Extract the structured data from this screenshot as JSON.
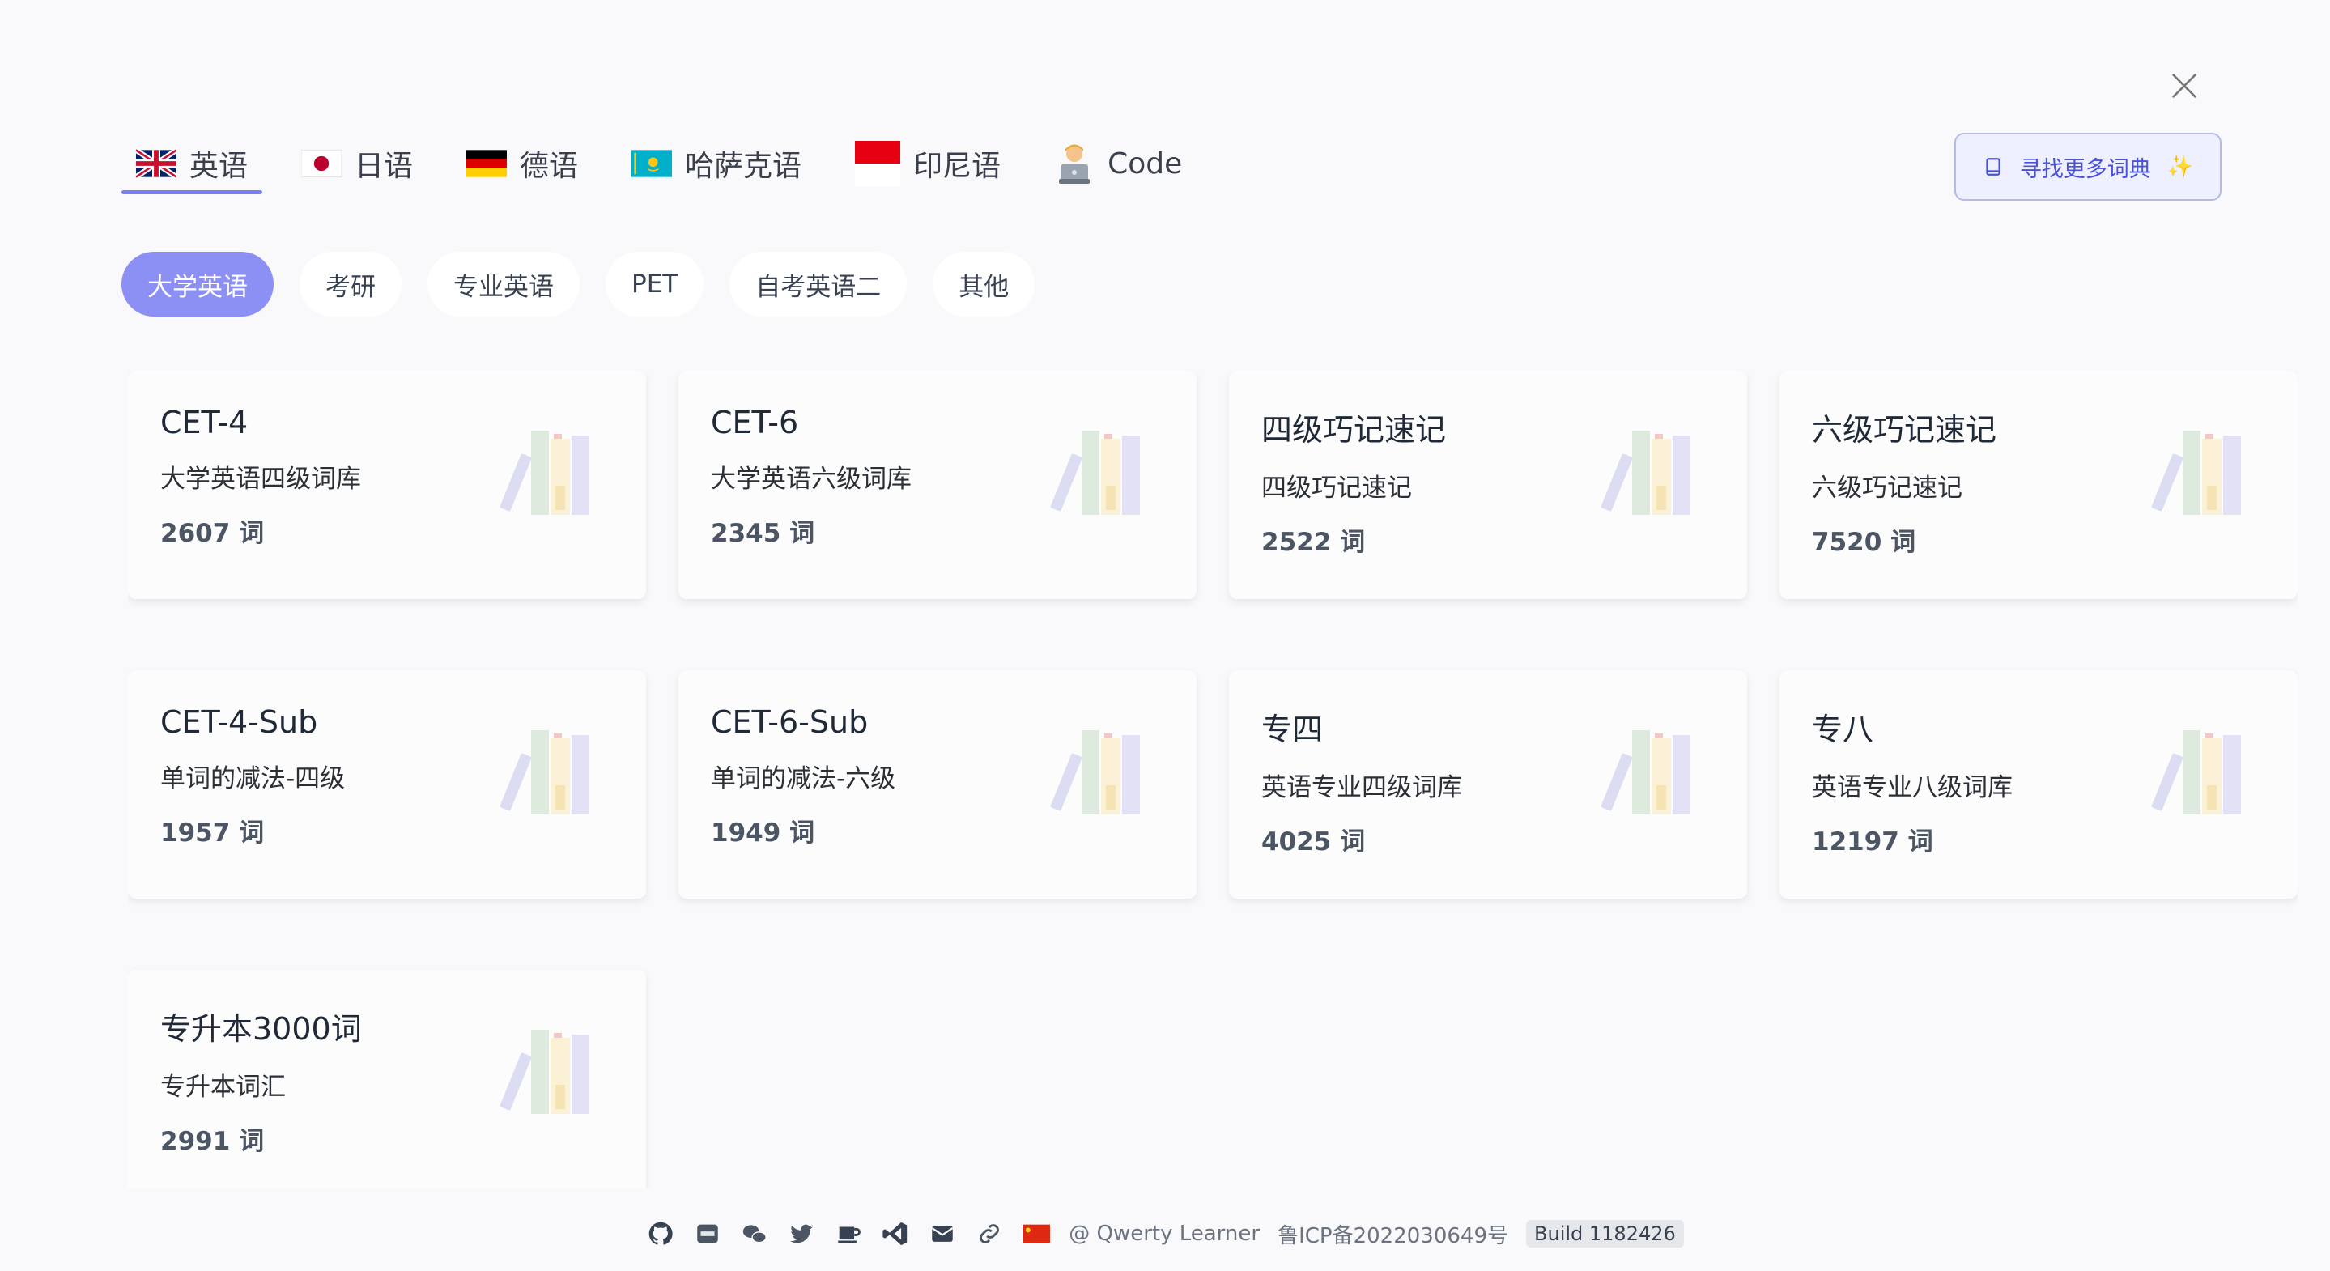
{
  "languages": [
    {
      "label": "英语",
      "flag": "uk-flag",
      "active": true
    },
    {
      "label": "日语",
      "flag": "japan-flag",
      "active": false
    },
    {
      "label": "德语",
      "flag": "germany-flag",
      "active": false
    },
    {
      "label": "哈萨克语",
      "flag": "kazakhstan-flag",
      "active": false
    },
    {
      "label": "印尼语",
      "flag": "indonesia-flag",
      "active": false
    },
    {
      "label": "Code",
      "flag": "coder-emoji",
      "active": false
    }
  ],
  "more_dict_button": {
    "label": "寻找更多词典",
    "icon": "book-icon",
    "sparkle": "✨"
  },
  "categories": [
    {
      "label": "大学英语",
      "active": true
    },
    {
      "label": "考研",
      "active": false
    },
    {
      "label": "专业英语",
      "active": false
    },
    {
      "label": "PET",
      "active": false
    },
    {
      "label": "自考英语二",
      "active": false
    },
    {
      "label": "其他",
      "active": false
    }
  ],
  "dictionaries": [
    {
      "title": "CET-4",
      "desc": "大学英语四级词库",
      "count": "2607 词"
    },
    {
      "title": "CET-6",
      "desc": "大学英语六级词库",
      "count": "2345 词"
    },
    {
      "title": "四级巧记速记",
      "desc": "四级巧记速记",
      "count": "2522 词"
    },
    {
      "title": "六级巧记速记",
      "desc": "六级巧记速记",
      "count": "7520 词"
    },
    {
      "title": "CET-4-Sub",
      "desc": "单词的减法-四级",
      "count": "1957 词"
    },
    {
      "title": "CET-6-Sub",
      "desc": "单词的减法-六级",
      "count": "1949 词"
    },
    {
      "title": "专四",
      "desc": "英语专业四级词库",
      "count": "4025 词"
    },
    {
      "title": "专八",
      "desc": "英语专业八级词库",
      "count": "12197 词"
    },
    {
      "title": "专升本3000词",
      "desc": "专升本词汇",
      "count": "2991 词"
    }
  ],
  "footer": {
    "icons": [
      "github-icon",
      "weibo-icon",
      "wechat-icon",
      "twitter-icon",
      "coffee-icon",
      "vscode-icon",
      "mail-icon",
      "link-icon",
      "china-flag-icon"
    ],
    "author": "@ Qwerty Learner",
    "icp": "鲁ICP备2022030649号",
    "build": "Build 1182426"
  },
  "colors": {
    "accent": "#8c8ff4",
    "tab_underline": "#7a7ff2",
    "button_text": "#4a52d8"
  }
}
